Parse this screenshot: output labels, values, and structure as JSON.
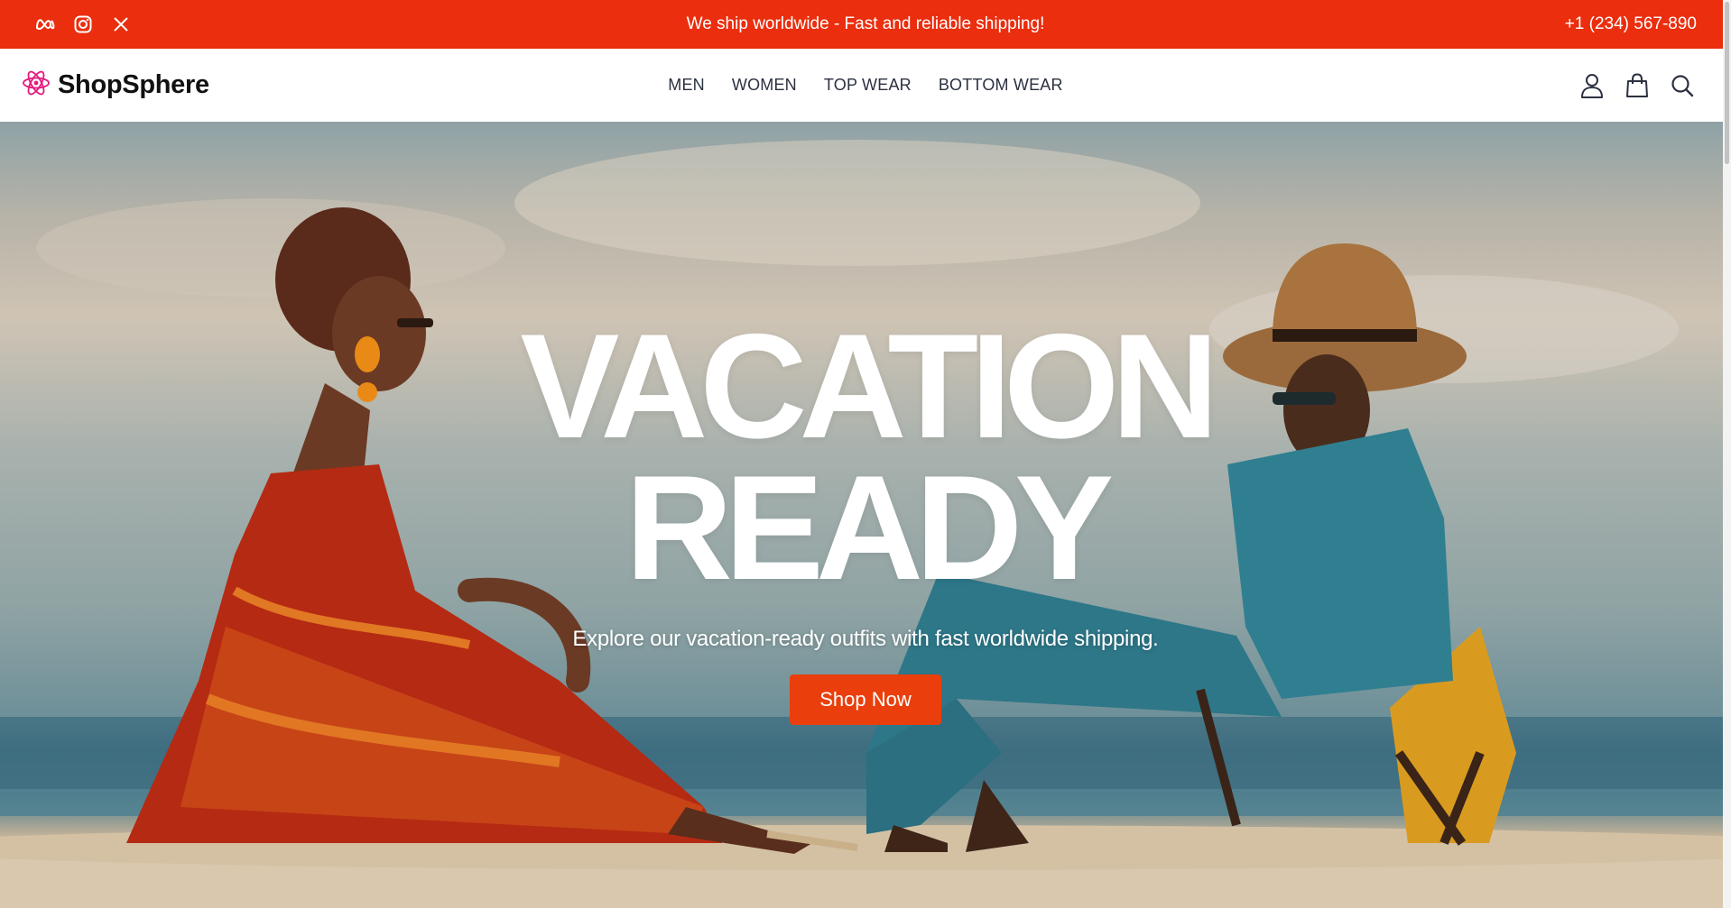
{
  "topbar": {
    "social": [
      {
        "name": "meta-icon"
      },
      {
        "name": "instagram-icon"
      },
      {
        "name": "x-twitter-icon"
      }
    ],
    "announcement": "We ship worldwide - Fast and reliable shipping!",
    "phone": "+1 (234) 567-890"
  },
  "header": {
    "logo_text": "ShopSphere",
    "logo_icon": "atom-icon",
    "nav": [
      {
        "label": "MEN"
      },
      {
        "label": "WOMEN"
      },
      {
        "label": "TOP WEAR"
      },
      {
        "label": "BOTTOM WEAR"
      }
    ],
    "icons": [
      "user-icon",
      "shopping-bag-icon",
      "search-icon"
    ]
  },
  "hero": {
    "title_line1": "VACATION",
    "title_line2": "READY",
    "subtitle": "Explore our vacation-ready outfits with fast worldwide shipping.",
    "cta_label": "Shop Now"
  },
  "colors": {
    "topbar_bg": "#ea2e0e",
    "accent_button": "#ea3f0c",
    "logo_icon": "#e5197d",
    "nav_text": "#2b3140"
  }
}
